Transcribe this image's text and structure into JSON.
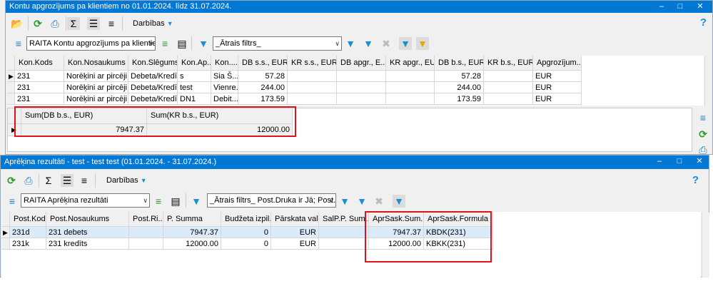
{
  "top_window": {
    "title": "Kontu apgrozījums pa klientiem no 01.01.2024. līdz 31.07.2024.",
    "actions_label": "Darbības",
    "report_select": "RAITA Kontu apgrozījums pa klientiem",
    "filter_select": "_Ātrais filtrs_",
    "columns": [
      "Kon.Kods",
      "Kon.Nosaukums",
      "Kon.Slēgums",
      "Kon.Ap...",
      "Kon....",
      "DB s.s., EUR",
      "KR s.s., EUR",
      "DB apgr., E...",
      "KR apgr., EUR",
      "DB b.s., EUR",
      "KR b.s., EUR",
      "Apgrozījum..."
    ],
    "rows": [
      [
        "231",
        "Norēķini ar pircēji...",
        "Debeta/Kredīta",
        "s",
        "Sia Š...",
        "57.28",
        "",
        "",
        "",
        "57.28",
        "",
        "EUR"
      ],
      [
        "231",
        "Norēķini ar pircēji...",
        "Debeta/Kredīta",
        "test",
        "Vienre...",
        "244.00",
        "",
        "",
        "",
        "244.00",
        "",
        "EUR"
      ],
      [
        "231",
        "Norēķini ar pircēji...",
        "Debeta/Kredīta",
        "DN1",
        "Debit...",
        "173.59",
        "",
        "",
        "",
        "173.59",
        "",
        "EUR"
      ]
    ],
    "summary_columns": [
      "Sum(DB b.s., EUR)",
      "Sum(KR b.s., EUR)"
    ],
    "summary_values": [
      "7947.37",
      "12000.00"
    ],
    "help": "?"
  },
  "bottom_window": {
    "title": "Aprēķina rezultāti - test - test test (01.01.2024. - 31.07.2024.)",
    "actions_label": "Darbības",
    "report_select": "RAITA Aprēķina rezultāti",
    "filter_select": "_Ātrais filtrs_ Post.Druka ir Jā; Post.K",
    "columns": [
      "Post.Kods",
      "Post.Nosaukums",
      "Post.Ri...",
      "P. Summa",
      "Budžeta izpil...",
      "Pārskata val...",
      "SalP.P. Sum...",
      "AprSask.Sum...",
      "AprSask.Formula"
    ],
    "rows": [
      [
        "231d",
        "231 debets",
        "",
        "7947.37",
        "0",
        "EUR",
        "",
        "7947.37",
        "KBDK(231)"
      ],
      [
        "231k",
        "231 kredīts",
        "",
        "12000.00",
        "0",
        "EUR",
        "",
        "12000.00",
        "KBKK(231)"
      ]
    ],
    "help": "?"
  },
  "colors": {
    "titlebar": "#0078d4",
    "highlight": "#e0121e",
    "selected_row": "#dcebfa"
  }
}
